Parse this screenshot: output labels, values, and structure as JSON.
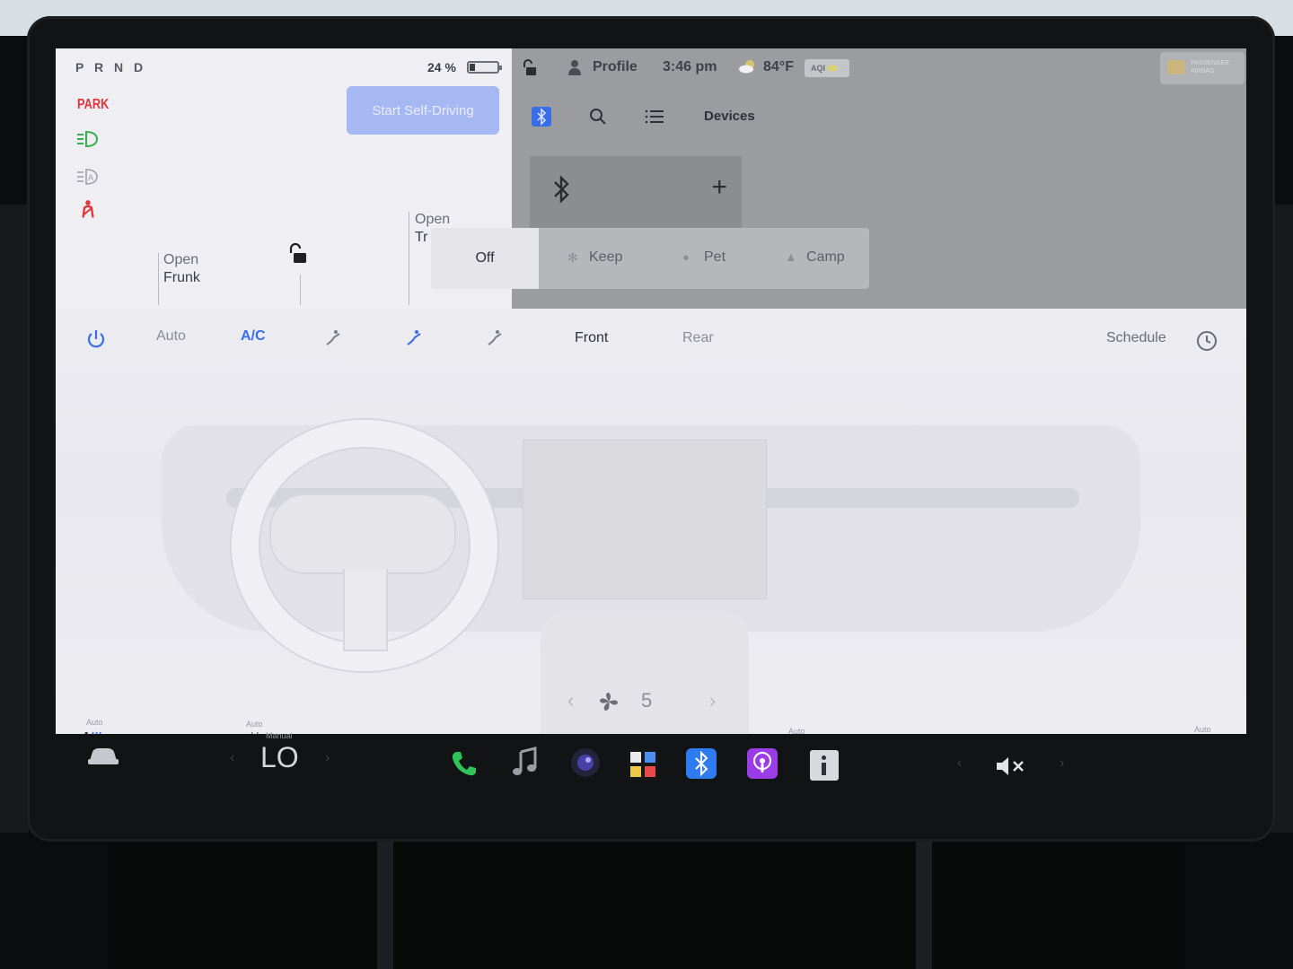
{
  "status": {
    "gear": "P R N D",
    "park": "PARK",
    "battery_percent": "24 %",
    "battery_fraction": 0.24
  },
  "autopilot": {
    "button_label": "Start Self-Driving"
  },
  "frunk": {
    "line1": "Open",
    "line2": "Frunk"
  },
  "trunk": {
    "line1": "Open",
    "line2": "Tr"
  },
  "topbar": {
    "profile": "Profile",
    "time": "3:46 pm",
    "temperature": "84°F",
    "aqi_label": "AQI",
    "airbag_line1": "PASSENGER",
    "airbag_line2": "AIRBAG"
  },
  "bluetooth_panel": {
    "title": "Devices"
  },
  "modes": {
    "off": "Off",
    "keep": "Keep",
    "pet": "Pet",
    "camp": "Camp"
  },
  "climate": {
    "auto": "Auto",
    "ac": "A/C",
    "front": "Front",
    "rear": "Rear",
    "schedule": "Schedule",
    "fan_speed": "5",
    "auto_small": "Auto"
  },
  "dock": {
    "temp_mode": "Manual",
    "temp_value": "LO"
  },
  "colors": {
    "accent_blue": "#3a6ee8",
    "park_red": "#e0373c",
    "phone_green": "#2fc35a",
    "podcast_purple": "#9b3de6"
  }
}
